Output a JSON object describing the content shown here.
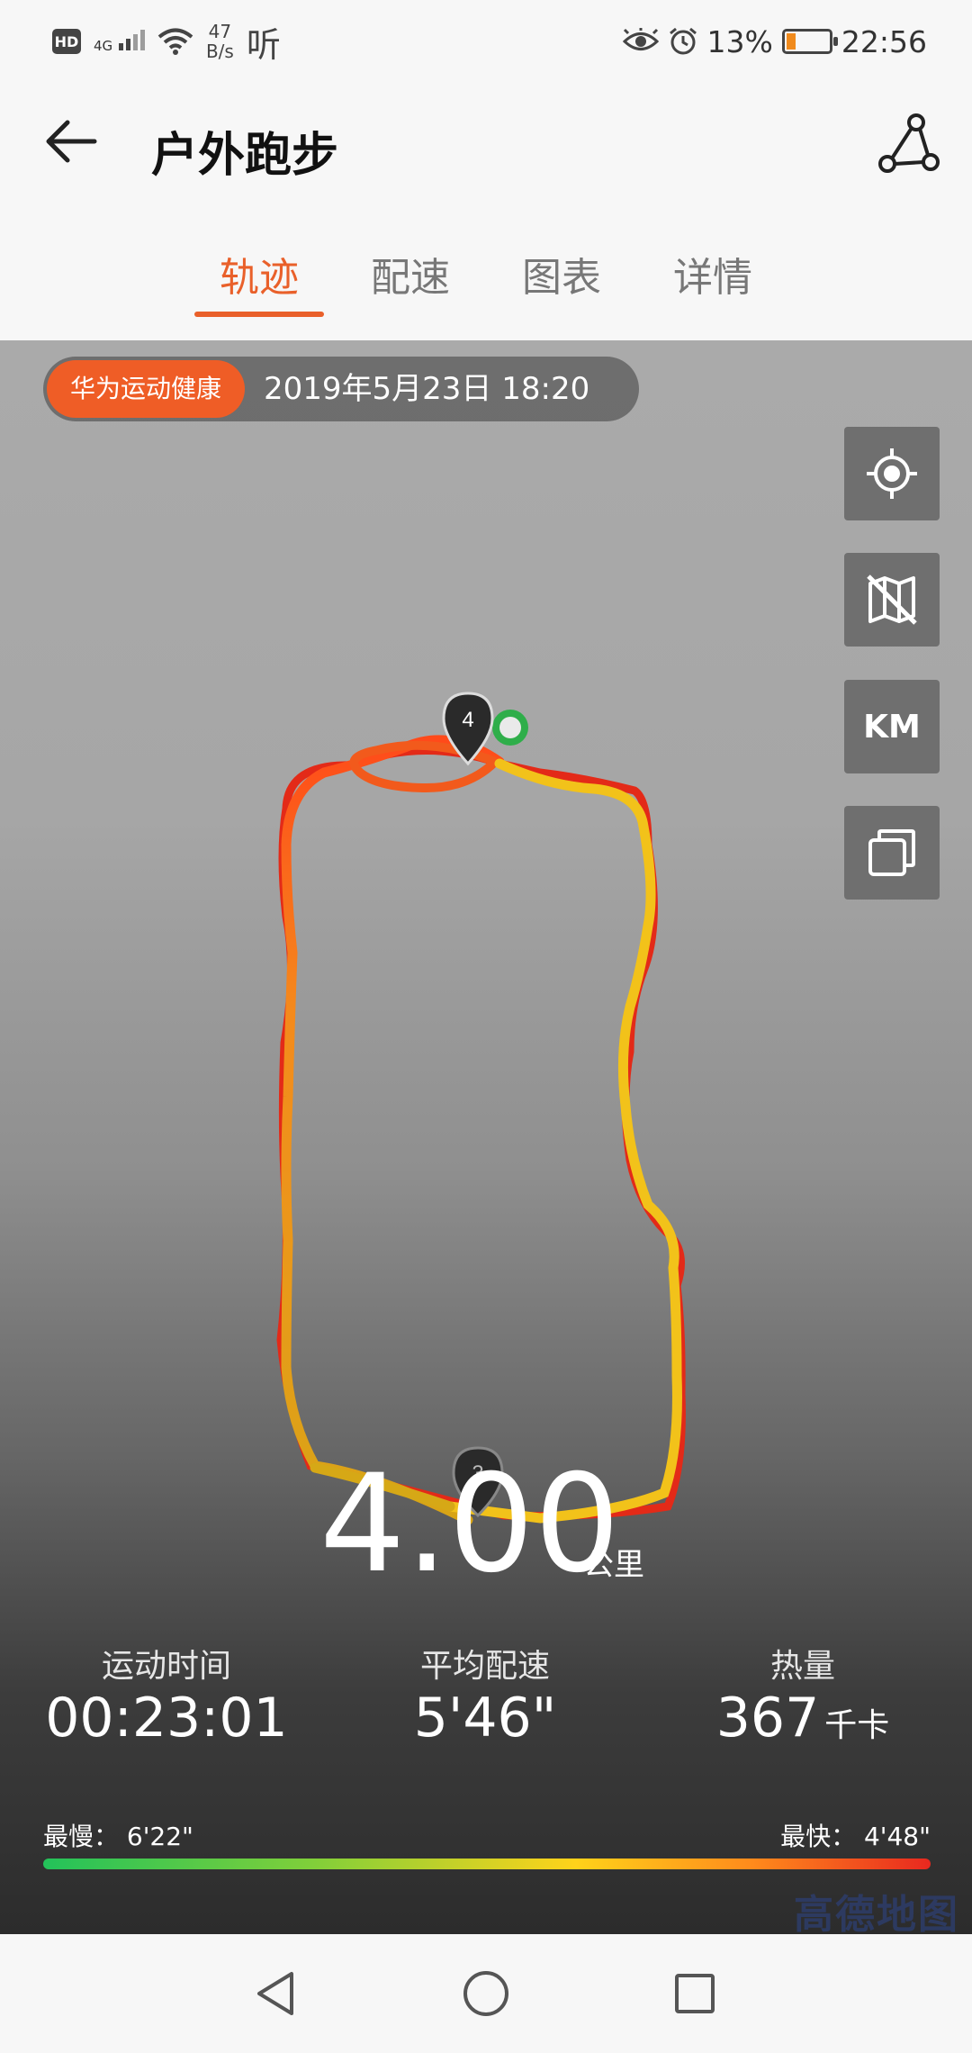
{
  "status_bar": {
    "hd": "HD",
    "network": "4G",
    "speed_value": "47",
    "speed_unit": "B/s",
    "app_indicator": "听",
    "battery_percent": "13%",
    "time": "22:56"
  },
  "header": {
    "title": "户外跑步"
  },
  "tabs": [
    {
      "label": "轨迹",
      "active": true
    },
    {
      "label": "配速",
      "active": false
    },
    {
      "label": "图表",
      "active": false
    },
    {
      "label": "详情",
      "active": false
    }
  ],
  "map": {
    "brand_badge": "华为运动健康",
    "datetime": "2019年5月23日 18:20",
    "controls": {
      "locate_icon": "crosshair-icon",
      "map_toggle_icon": "map-off-icon",
      "km_label": "KM",
      "layers_icon": "layers-icon"
    },
    "markers": [
      "4",
      "3"
    ],
    "watermark": "高德地图"
  },
  "summary": {
    "distance": "4.00",
    "distance_unit": "公里",
    "stats": [
      {
        "label": "运动时间",
        "value": "00:23:01",
        "unit": ""
      },
      {
        "label": "平均配速",
        "value": "5'46\"",
        "unit": ""
      },
      {
        "label": "热量",
        "value": "367",
        "unit": "千卡"
      }
    ]
  },
  "pace_legend": {
    "slowest": "最慢： 6'22\"",
    "fastest": "最快： 4'48\""
  },
  "colors": {
    "accent": "#e9602a",
    "slow": "#23c25a",
    "fast": "#e8281f"
  }
}
